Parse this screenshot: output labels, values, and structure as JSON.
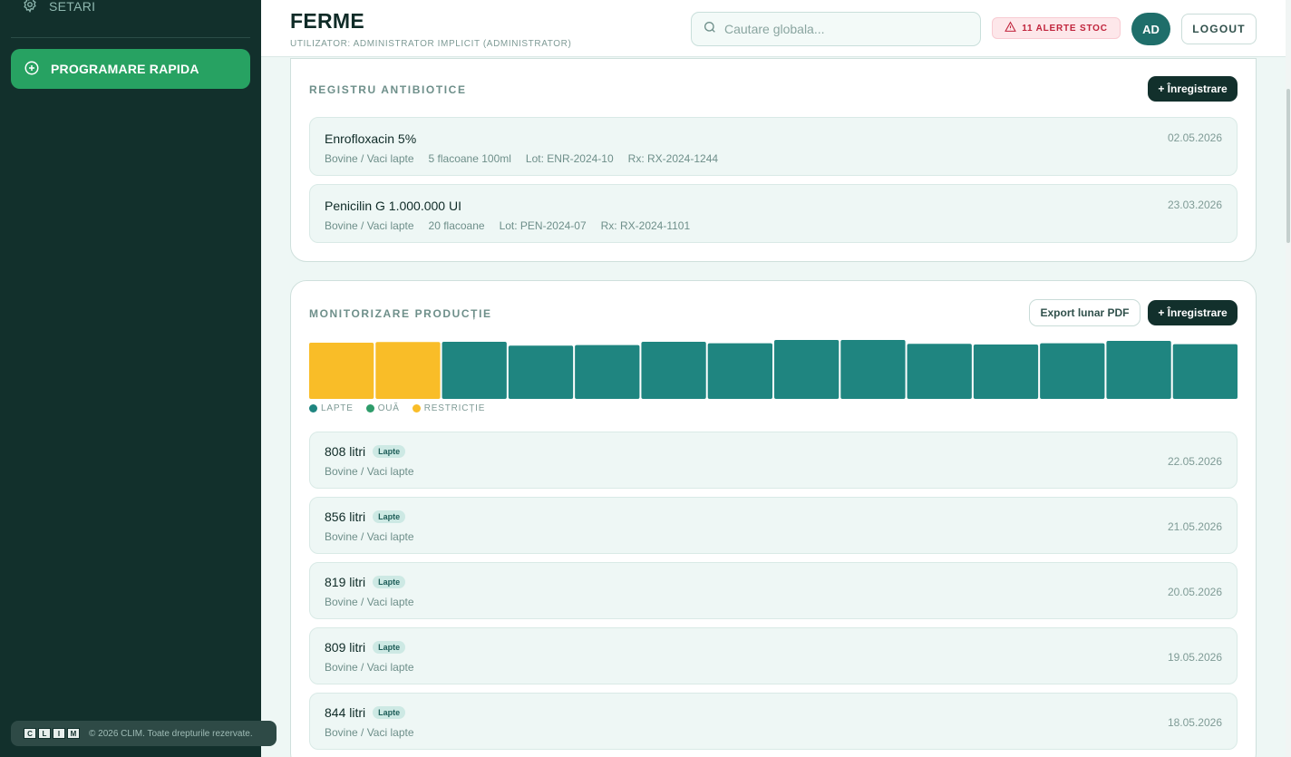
{
  "sidebar": {
    "settings_label": "SETARI",
    "quick_button_label": "PROGRAMARE RAPIDA",
    "logo_letters": [
      "C",
      "L",
      "I",
      "M"
    ],
    "footer_text": "© 2026 CLIM. Toate drepturile rezervate."
  },
  "header": {
    "title": "FERME",
    "subtitle": "UTILIZATOR: ADMINISTRATOR IMPLICIT (ADMINISTRATOR)",
    "search_placeholder": "Cautare globala...",
    "alert_label": "11 ALERTE STOC",
    "avatar_initials": "AD",
    "logout_label": "LOGOUT"
  },
  "antibiotics": {
    "title": "REGISTRU ANTIBIOTICE",
    "add_label": "+ Înregistrare",
    "items": [
      {
        "name": "Enrofloxacin 5%",
        "date": "02.05.2026",
        "species": "Bovine / Vaci lapte",
        "quantity": "5 flacoane 100ml",
        "lot": "Lot: ENR-2024-10",
        "rx": "Rx: RX-2024-1244"
      },
      {
        "name": "Penicilin G 1.000.000 UI",
        "date": "23.03.2026",
        "species": "Bovine / Vaci lapte",
        "quantity": "20 flacoane",
        "lot": "Lot: PEN-2024-07",
        "rx": "Rx: RX-2024-1101"
      }
    ]
  },
  "production": {
    "title": "MONITORIZARE PRODUCȚIE",
    "export_label": "Export lunar PDF",
    "add_label": "+ Înregistrare",
    "legend": [
      {
        "label": "LAPTE",
        "color": "#1f8580"
      },
      {
        "label": "OUĂ",
        "color": "#2e9c6a"
      },
      {
        "label": "RESTRICȚIE",
        "color": "#f9bd28"
      }
    ],
    "items": [
      {
        "value": "808 litri",
        "tag": "Lapte",
        "species": "Bovine / Vaci lapte",
        "date": "22.05.2026"
      },
      {
        "value": "856 litri",
        "tag": "Lapte",
        "species": "Bovine / Vaci lapte",
        "date": "21.05.2026"
      },
      {
        "value": "819 litri",
        "tag": "Lapte",
        "species": "Bovine / Vaci lapte",
        "date": "20.05.2026"
      },
      {
        "value": "809 litri",
        "tag": "Lapte",
        "species": "Bovine / Vaci lapte",
        "date": "19.05.2026"
      },
      {
        "value": "844 litri",
        "tag": "Lapte",
        "species": "Bovine / Vaci lapte",
        "date": "18.05.2026"
      }
    ]
  },
  "chart_data": {
    "type": "bar",
    "values": [
      0.94,
      0.95,
      0.955,
      0.89,
      0.9,
      0.955,
      0.93,
      0.985,
      0.985,
      0.92,
      0.91,
      0.93,
      0.97,
      0.915
    ],
    "restriction": [
      true,
      true,
      false,
      false,
      false,
      false,
      false,
      false,
      false,
      false,
      false,
      false,
      false,
      false
    ],
    "colors": {
      "lapte": "#1f8580",
      "restrictie": "#f9bd28"
    },
    "grid": false
  }
}
